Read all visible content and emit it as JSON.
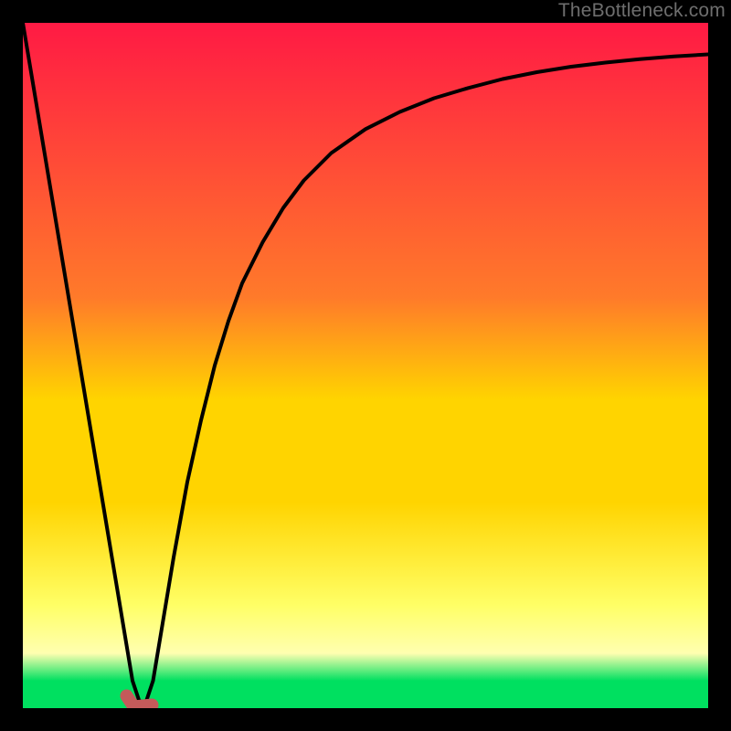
{
  "watermark": "TheBottleneck.com",
  "colors": {
    "background": "#000000",
    "gradient_top": "#ff1a44",
    "gradient_upper_mid": "#ff7a2a",
    "gradient_mid": "#ffd400",
    "gradient_lower_mid": "#ffff66",
    "gradient_light": "#ffffb0",
    "gradient_green": "#00e060",
    "curve": "#000000",
    "marker": "#c45a5a"
  },
  "chart_data": {
    "type": "line",
    "title": "",
    "xlabel": "",
    "ylabel": "",
    "xlim": [
      0,
      100
    ],
    "ylim": [
      0,
      100
    ],
    "x": [
      0,
      2,
      4,
      6,
      8,
      10,
      12,
      14,
      15,
      16,
      17,
      18,
      19,
      20,
      22,
      24,
      26,
      28,
      30,
      32,
      35,
      38,
      41,
      45,
      50,
      55,
      60,
      65,
      70,
      75,
      80,
      85,
      90,
      95,
      100
    ],
    "series": [
      {
        "name": "bottleneck-curve",
        "values": [
          100,
          88,
          76,
          64,
          52,
          40,
          28,
          16,
          10,
          4,
          1,
          1,
          4,
          10,
          22,
          33,
          42,
          50,
          56.5,
          62,
          68,
          73,
          77,
          81,
          84.5,
          87,
          89,
          90.5,
          91.8,
          92.8,
          93.6,
          94.2,
          94.7,
          95.1,
          95.4
        ]
      }
    ],
    "marker": {
      "x": 17,
      "y": 1
    },
    "gradient_stops_percent": [
      0,
      40,
      55,
      70,
      85,
      92,
      96,
      100
    ],
    "gradient_stop_colors": [
      "gradient_top",
      "gradient_upper_mid",
      "gradient_mid",
      "gradient_mid",
      "gradient_lower_mid",
      "gradient_light",
      "gradient_green",
      "gradient_green"
    ]
  }
}
